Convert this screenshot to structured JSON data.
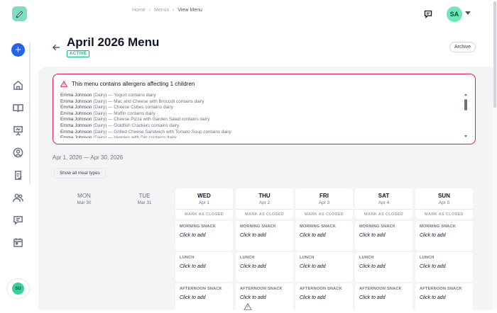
{
  "breadcrumb": {
    "home": "Home",
    "menus": "Menus",
    "current": "View Menu",
    "sep": "›"
  },
  "user": {
    "initials": "SA",
    "sidebar_initials": "SU"
  },
  "page": {
    "title": "April 2026 Menu",
    "status": "ACTIVE",
    "archive_label": "Archive"
  },
  "alert": {
    "title": "This menu contains allergens affecting 1 children",
    "items": [
      {
        "child": "Emma Johnson",
        "detail": " (Dairy) — Yogurt contains dairy"
      },
      {
        "child": "Emma Johnson",
        "detail": " (Dairy) — Mac and Cheese with Broccoli contains dairy"
      },
      {
        "child": "Emma Johnson",
        "detail": " (Dairy) — Cheese Cubes contains dairy"
      },
      {
        "child": "Emma Johnson",
        "detail": " (Dairy) — Muffin contains dairy"
      },
      {
        "child": "Emma Johnson",
        "detail": " (Dairy) — Cheese Pizza with Garden Salad contains dairy"
      },
      {
        "child": "Emma Johnson",
        "detail": " (Dairy) — Goldfish Crackers contains dairy"
      },
      {
        "child": "Emma Johnson",
        "detail": " (Dairy) — Grilled Cheese Sandwich with Tomato Soup contains dairy"
      },
      {
        "child": "Emma Johnson",
        "detail": " (Dairy) — Veggies with Dip contains dairy"
      }
    ]
  },
  "date_range": "Apr 1, 2026 — Apr 30, 2026",
  "meal_toggle": "Show all meal types",
  "mark_closed": "MARK AS CLOSED",
  "click_to_add": "Click to add",
  "meal_types": [
    "MORNING SNACK",
    "LUNCH",
    "AFTERNOON SNACK"
  ],
  "days": [
    {
      "name": "MON",
      "date": "Mar 30",
      "active": false
    },
    {
      "name": "TUE",
      "date": "Mar 31",
      "active": false
    },
    {
      "name": "WED",
      "date": "Apr 1",
      "active": true
    },
    {
      "name": "THU",
      "date": "Apr 2",
      "active": true
    },
    {
      "name": "FRI",
      "date": "Apr 3",
      "active": true
    },
    {
      "name": "SAT",
      "date": "Apr 4",
      "active": true
    },
    {
      "name": "SUN",
      "date": "Apr 5",
      "active": true
    }
  ],
  "colors": {
    "brand": "#7be0c2",
    "primary": "#2563eb",
    "danger": "#e11d48",
    "success": "#10b981"
  },
  "icons": {
    "sidebar": [
      "home-icon",
      "book-icon",
      "presentation-icon",
      "user-circle-icon",
      "clipboard-check-icon",
      "users-icon",
      "message-icon",
      "calendar-icon"
    ]
  }
}
